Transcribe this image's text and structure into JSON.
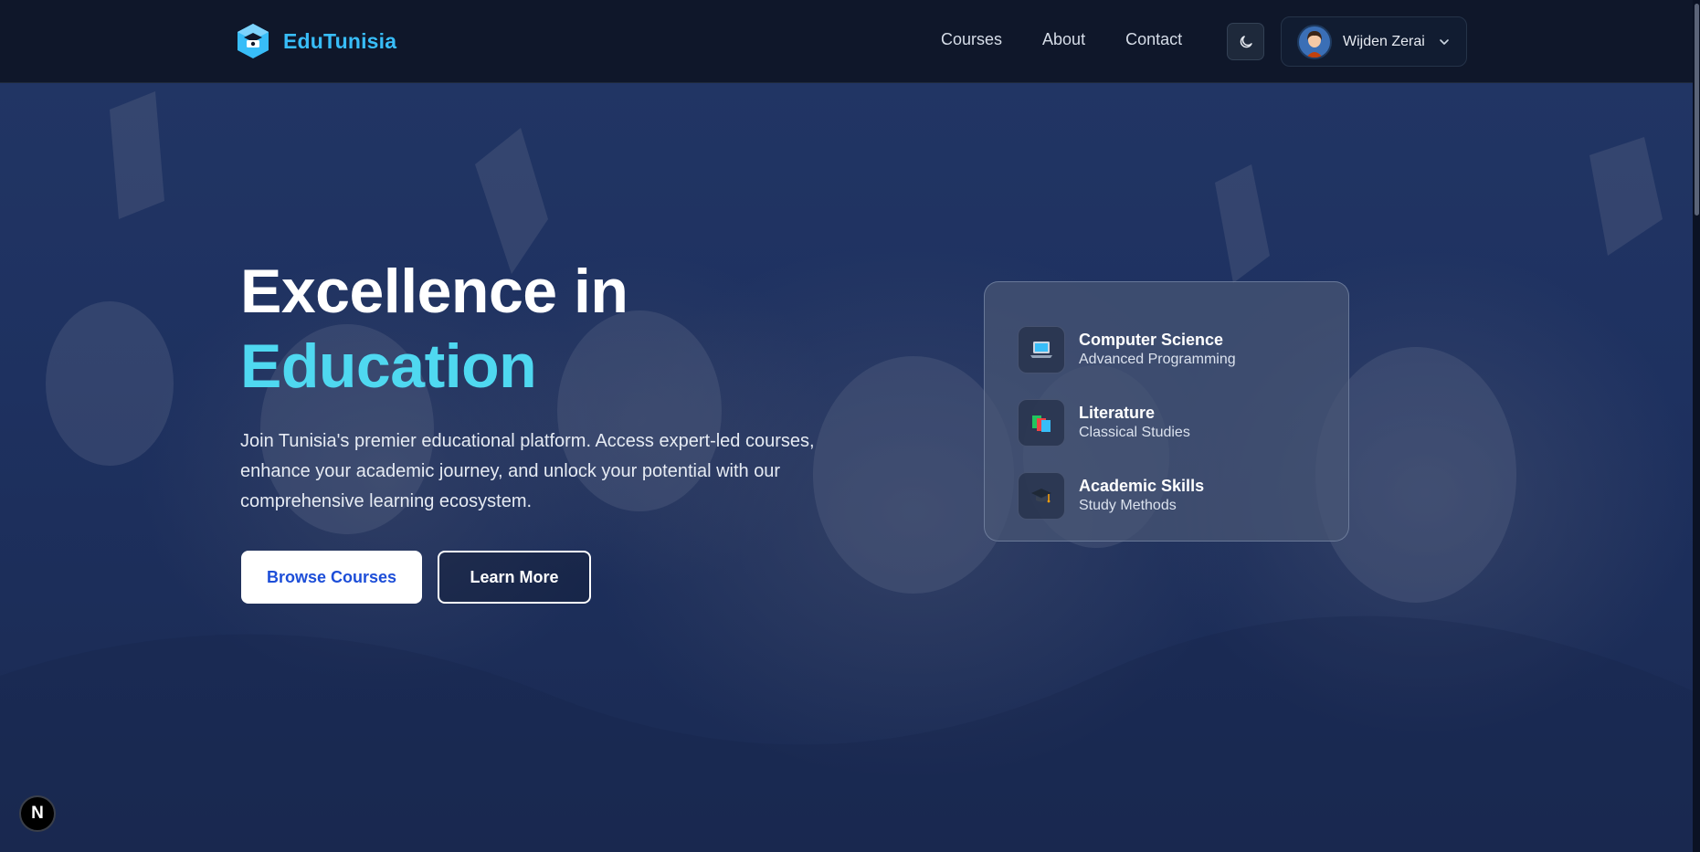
{
  "header": {
    "brand_name": "EduTunisia",
    "nav": [
      {
        "label": "Courses"
      },
      {
        "label": "About"
      },
      {
        "label": "Contact"
      }
    ],
    "theme_toggle_icon": "moon-icon",
    "user": {
      "name": "Wijden Zerai",
      "menu_icon": "chevron-down-icon"
    }
  },
  "hero": {
    "title_line1": "Excellence in",
    "title_line2": "Education",
    "description": "Join Tunisia's premier educational platform. Access expert-led courses, enhance your academic journey, and unlock your potential with our comprehensive learning ecosystem.",
    "primary_button": "Browse Courses",
    "secondary_button": "Learn More"
  },
  "featured_courses": [
    {
      "title": "Computer Science",
      "subtitle": "Advanced Programming",
      "icon": "laptop-icon"
    },
    {
      "title": "Literature",
      "subtitle": "Classical Studies",
      "icon": "books-icon"
    },
    {
      "title": "Academic Skills",
      "subtitle": "Study Methods",
      "icon": "graduation-cap-icon"
    }
  ],
  "dev_badge": {
    "label": "N"
  },
  "colors": {
    "header_bg": "#0f172a",
    "brand": "#38bdf8",
    "accent": "#4fd8f0",
    "primary_button_text": "#1d4ed8",
    "hero_bg": "#1e3160"
  }
}
